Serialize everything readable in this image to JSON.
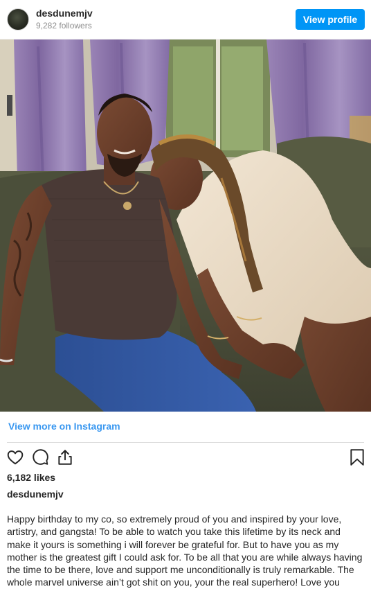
{
  "header": {
    "username": "desdunemjv",
    "followers": "9,282 followers",
    "view_profile_label": "View profile"
  },
  "photo": {
    "alt": "Photo shared by desdunemjv"
  },
  "links": {
    "view_more": "View more on Instagram"
  },
  "actions": {
    "icons": [
      "heart-icon",
      "comment-icon",
      "share-icon",
      "bookmark-icon"
    ]
  },
  "post": {
    "likes": "6,182 likes",
    "owner": "desdunemjv",
    "caption": "Happy birthday to my co, so extremely proud of you and inspired by your love, artistry, and gangsta! To be able to watch you take this lifetime by its neck and make it yours is something i will forever be grateful for. But to have you as my mother is the greatest gift I could ask for. To be all that you are while always having the time to be there, love and support me unconditionally is truly remarkable. The whole marvel universe ain’t got shit on you, your the real superhero! Love you"
  },
  "colors": {
    "accent": "#0095f6",
    "link": "#3897f0",
    "text": "#262626",
    "muted": "#8e8e8e"
  }
}
